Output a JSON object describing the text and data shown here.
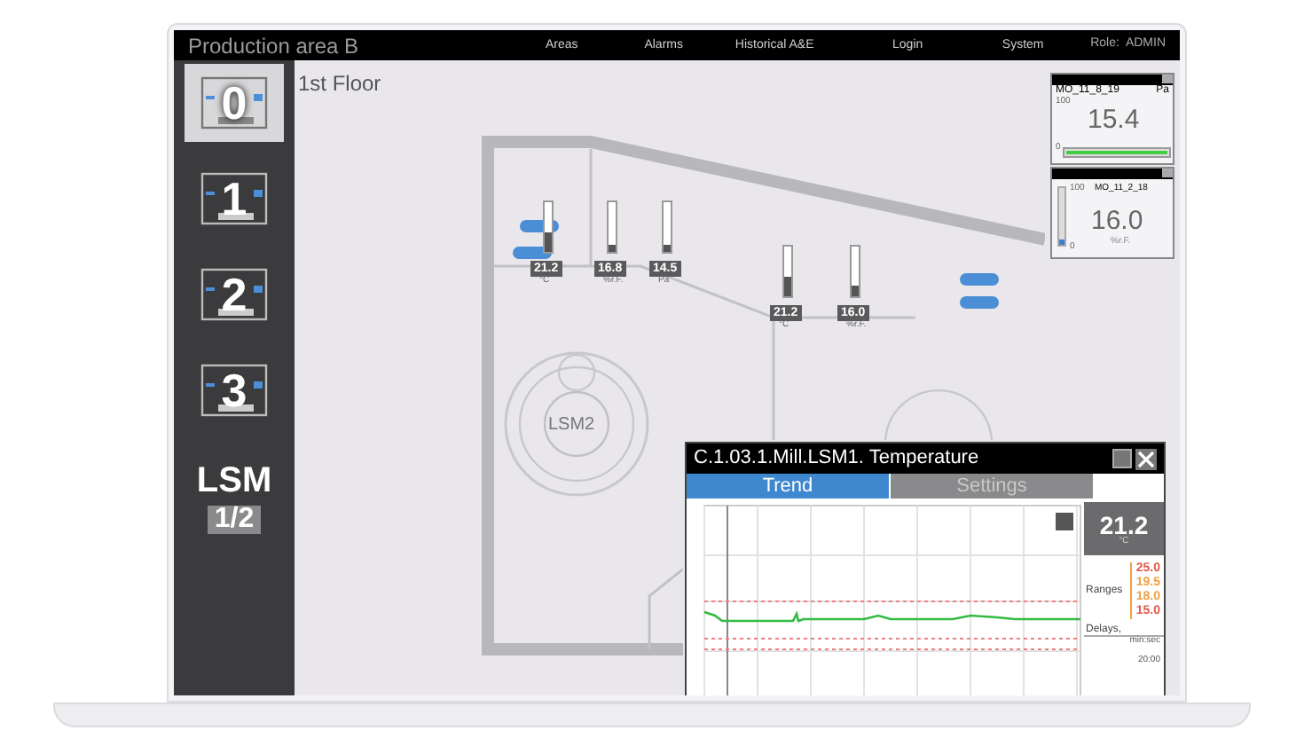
{
  "header": {
    "title": "Production area B",
    "nav": [
      {
        "label": "Areas"
      },
      {
        "label": "Alarms"
      },
      {
        "label": "Historical A&E"
      },
      {
        "label": "Login"
      },
      {
        "label": "System"
      }
    ],
    "role": "Role:  ADMIN"
  },
  "floors": [
    {
      "label": "0",
      "selected": true
    },
    {
      "label": "1",
      "selected": false
    },
    {
      "label": "2",
      "selected": false
    },
    {
      "label": "3",
      "selected": false
    },
    {
      "label": "LSM",
      "sublabel": "1/2",
      "selected": false
    }
  ],
  "floor_title": "1st Floor",
  "machine": "LSM2",
  "sensors": [
    {
      "value": "21.2",
      "unit": "°C",
      "level": 0.4
    },
    {
      "value": "16.8",
      "unit": "%r.F.",
      "level": 0.15
    },
    {
      "value": "14.5",
      "unit": "Pa",
      "level": 0.15
    },
    {
      "value": "21.2",
      "unit": "°C",
      "level": 0.4
    },
    {
      "value": "16.0",
      "unit": "%r.F.",
      "level": 0.2
    }
  ],
  "widgets": [
    {
      "kind": "horizontal",
      "tag": "MO_11_8_19",
      "unit": "Pa",
      "max": "100",
      "value": "15.4",
      "min": "0",
      "level": 1
    },
    {
      "kind": "vertical",
      "tag": "MO_11_2_18",
      "unit": "%r.F.",
      "max": "100",
      "value": "16.0",
      "min": "0",
      "level": 0.1
    }
  ],
  "popup": {
    "title": "C.1.03.1.Mill.LSM1. Temperature",
    "tabs": [
      {
        "label": "Trend",
        "selected": true
      },
      {
        "label": "Settings",
        "selected": false
      }
    ],
    "current": "21.2",
    "unit": "°C",
    "ranges_label": "Ranges",
    "ranges": [
      {
        "value": "25.0",
        "color": "#e05a4a"
      },
      {
        "value": "19.5",
        "color": "#f0a040"
      },
      {
        "value": "18.0",
        "color": "#f0a040"
      },
      {
        "value": "15.0",
        "color": "#e05a4a"
      }
    ],
    "delays_label": "Delays,",
    "delays_unit": "min:sec",
    "delay": "20:00"
  }
}
